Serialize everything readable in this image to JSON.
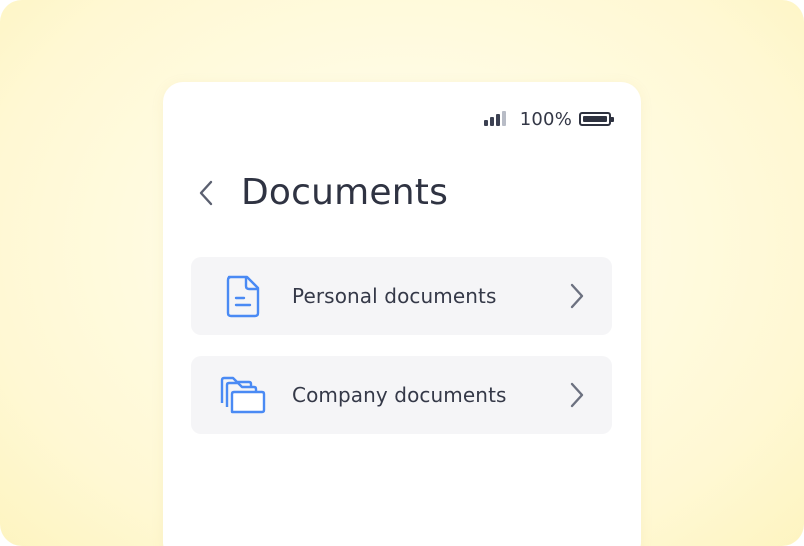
{
  "status_bar": {
    "battery_percent": "100%",
    "signal_icon": "signal-bars-icon",
    "battery_icon": "battery-full-icon"
  },
  "header": {
    "back_icon": "chevron-left-icon",
    "title": "Documents"
  },
  "list": {
    "items": [
      {
        "label": "Personal documents",
        "icon": "document-icon"
      },
      {
        "label": "Company documents",
        "icon": "folders-icon"
      }
    ]
  },
  "colors": {
    "accent": "#4a8af4",
    "background": "#fff9d6",
    "card": "#ffffff",
    "row": "#f5f5f7",
    "text": "#2f3342"
  }
}
